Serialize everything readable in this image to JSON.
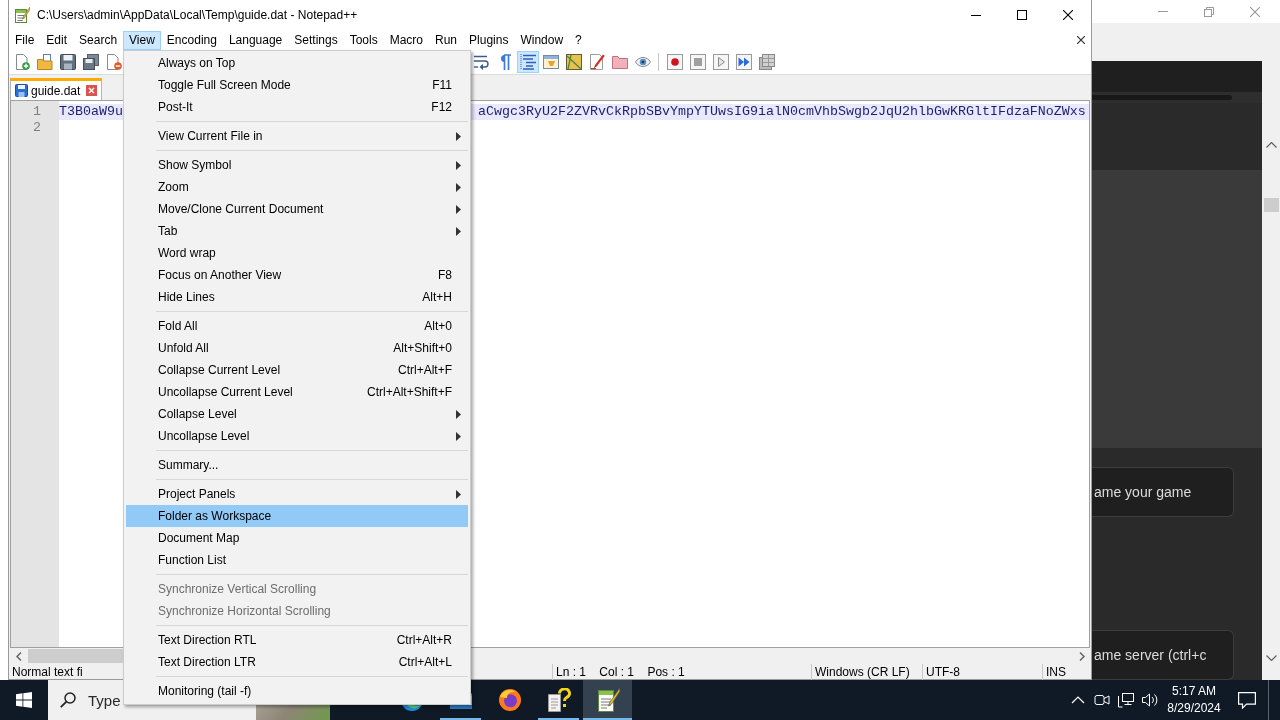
{
  "notepad_window": {
    "title": "C:\\Users\\admin\\AppData\\Local\\Temp\\guide.dat - Notepad++",
    "menu_bar": [
      {
        "label": "File",
        "selected": false
      },
      {
        "label": "Edit",
        "selected": false
      },
      {
        "label": "Search",
        "selected": false
      },
      {
        "label": "View",
        "selected": true
      },
      {
        "label": "Encoding",
        "selected": false
      },
      {
        "label": "Language",
        "selected": false
      },
      {
        "label": "Settings",
        "selected": false
      },
      {
        "label": "Tools",
        "selected": false
      },
      {
        "label": "Macro",
        "selected": false
      },
      {
        "label": "Run",
        "selected": false
      },
      {
        "label": "Plugins",
        "selected": false
      },
      {
        "label": "Window",
        "selected": false
      },
      {
        "label": "?",
        "selected": false
      }
    ],
    "toolbar": {
      "groups": [
        [
          {
            "kind": "page-plus",
            "selected": false
          },
          {
            "kind": "folder-pages",
            "selected": false
          },
          {
            "kind": "floppy",
            "selected": false
          },
          {
            "kind": "floppies",
            "selected": false
          },
          {
            "kind": "page-minus",
            "selected": false
          }
        ],
        [
          {
            "kind": "wrap-lines",
            "selected": false
          },
          {
            "kind": "pilcrow",
            "selected": false
          },
          {
            "kind": "indent-lines",
            "selected": true
          },
          {
            "kind": "window-panel",
            "selected": false
          },
          {
            "kind": "map-sheet",
            "selected": false
          },
          {
            "kind": "pen-page",
            "selected": false
          },
          {
            "kind": "folder",
            "selected": false
          },
          {
            "kind": "eye",
            "selected": false
          }
        ],
        [
          {
            "kind": "record",
            "selected": false
          },
          {
            "kind": "stop",
            "selected": false
          },
          {
            "kind": "play",
            "selected": false
          },
          {
            "kind": "fast-forward",
            "selected": false
          },
          {
            "kind": "grid-sheet",
            "selected": false
          }
        ]
      ]
    },
    "tabs": [
      {
        "label": "guide.dat",
        "selected": true
      }
    ],
    "editor": {
      "lines": [
        {
          "number": "1",
          "current": true,
          "segments": [
            "T3B0aW9u",
            "aCwgc3RyU2F2ZVRvCkRpbSBvYmpYTUwsIG9ialN0cmVhbSwgb2JqU2hlbGwKRGltIFdzaFNoZWxs"
          ]
        },
        {
          "number": "2",
          "current": false
        }
      ]
    },
    "status_bar": [
      "Normal text fi",
      "Ln : 1    Col : 1    Pos : 1",
      "Windows (CR LF)",
      "UTF-8",
      "INS"
    ]
  },
  "view_menu": {
    "groups": [
      [
        {
          "label": "Always on Top",
          "submenu": false,
          "disabled": false,
          "selected": false
        },
        {
          "label": "Toggle Full Screen Mode",
          "shortcut": "F11",
          "submenu": false,
          "disabled": false,
          "selected": false
        },
        {
          "label": "Post-It",
          "shortcut": "F12",
          "submenu": false,
          "disabled": false,
          "selected": false
        }
      ],
      [
        {
          "label": "View Current File in",
          "submenu": true,
          "disabled": false,
          "selected": false
        }
      ],
      [
        {
          "label": "Show Symbol",
          "submenu": true,
          "disabled": false,
          "selected": false
        },
        {
          "label": "Zoom",
          "submenu": true,
          "disabled": false,
          "selected": false
        },
        {
          "label": "Move/Clone Current Document",
          "submenu": true,
          "disabled": false,
          "selected": false
        },
        {
          "label": "Tab",
          "submenu": true,
          "disabled": false,
          "selected": false
        },
        {
          "label": "Word wrap",
          "submenu": false,
          "disabled": false,
          "selected": false
        },
        {
          "label": "Focus on Another View",
          "shortcut": "F8",
          "submenu": false,
          "disabled": false,
          "selected": false
        },
        {
          "label": "Hide Lines",
          "shortcut": "Alt+H",
          "submenu": false,
          "disabled": false,
          "selected": false
        }
      ],
      [
        {
          "label": "Fold All",
          "shortcut": "Alt+0",
          "submenu": false,
          "disabled": false,
          "selected": false
        },
        {
          "label": "Unfold All",
          "shortcut": "Alt+Shift+0",
          "submenu": false,
          "disabled": false,
          "selected": false
        },
        {
          "label": "Collapse Current Level",
          "shortcut": "Ctrl+Alt+F",
          "submenu": false,
          "disabled": false,
          "selected": false
        },
        {
          "label": "Uncollapse Current Level",
          "shortcut": "Ctrl+Alt+Shift+F",
          "submenu": false,
          "disabled": false,
          "selected": false
        },
        {
          "label": "Collapse Level",
          "submenu": true,
          "disabled": false,
          "selected": false
        },
        {
          "label": "Uncollapse Level",
          "submenu": true,
          "disabled": false,
          "selected": false
        }
      ],
      [
        {
          "label": "Summary...",
          "submenu": false,
          "disabled": false,
          "selected": false
        }
      ],
      [
        {
          "label": "Project Panels",
          "submenu": true,
          "disabled": false,
          "selected": false
        },
        {
          "label": "Folder as Workspace",
          "submenu": false,
          "disabled": false,
          "selected": true
        },
        {
          "label": "Document Map",
          "submenu": false,
          "disabled": false,
          "selected": false
        },
        {
          "label": "Function List",
          "submenu": false,
          "disabled": false,
          "selected": false
        }
      ],
      [
        {
          "label": "Synchronize Vertical Scrolling",
          "submenu": false,
          "disabled": true,
          "selected": false
        },
        {
          "label": "Synchronize Horizontal Scrolling",
          "submenu": false,
          "disabled": true,
          "selected": false
        }
      ],
      [
        {
          "label": "Text Direction RTL",
          "shortcut": "Ctrl+Alt+R",
          "submenu": false,
          "disabled": false,
          "selected": false
        },
        {
          "label": "Text Direction LTR",
          "shortcut": "Ctrl+Alt+L",
          "submenu": false,
          "disabled": false,
          "selected": false
        }
      ],
      [
        {
          "label": "Monitoring (tail -f)",
          "submenu": false,
          "disabled": false,
          "selected": false
        }
      ]
    ]
  },
  "background_window": {
    "buttons": [
      {
        "label": "ame your game"
      },
      {
        "label": "ame server (ctrl+c"
      }
    ]
  },
  "taskbar": {
    "search": {
      "placeholder": "Type"
    },
    "apps": [
      {
        "kind": "wave",
        "selected": false,
        "running": false
      },
      {
        "kind": "folder",
        "selected": false,
        "running": true
      },
      {
        "kind": "flame-globe",
        "selected": false,
        "running": false
      },
      {
        "kind": "help-document",
        "selected": false,
        "running": true
      },
      {
        "kind": "notepad",
        "selected": true,
        "running": true
      }
    ],
    "clock": {
      "time": "5:17 AM",
      "date": "8/29/2024"
    }
  }
}
